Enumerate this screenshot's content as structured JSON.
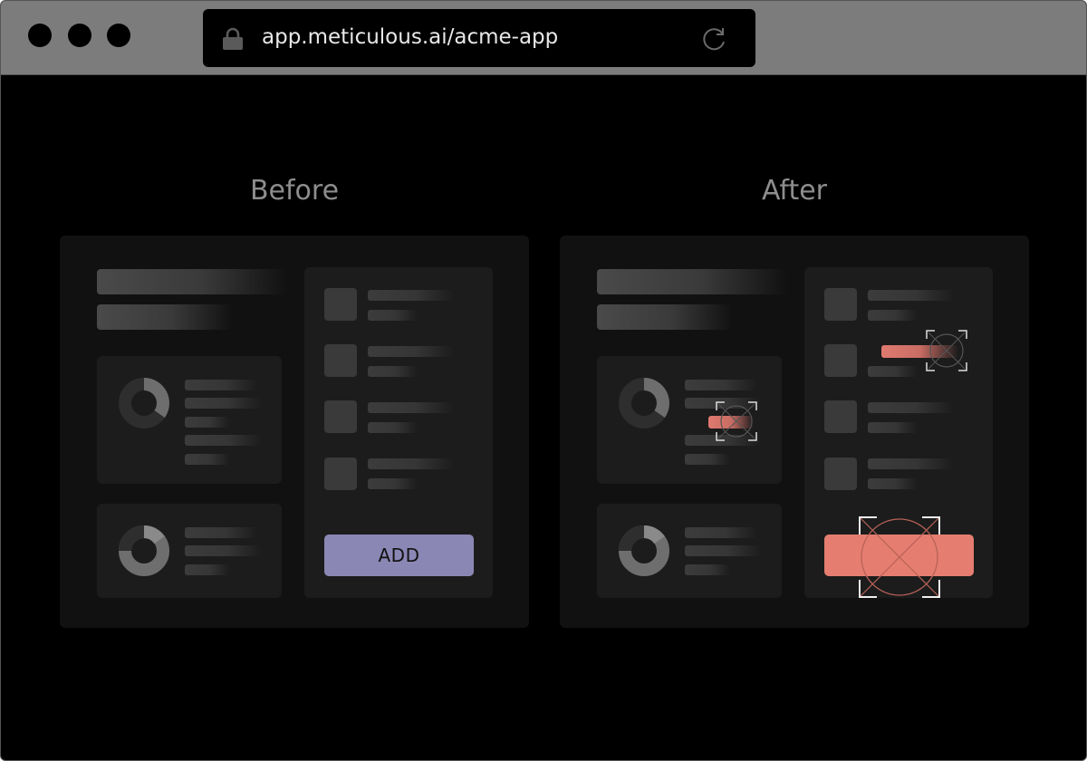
{
  "browser": {
    "url": "app.meticulous.ai/acme-app",
    "icons": [
      "lock-icon",
      "reload-icon"
    ]
  },
  "comparison": {
    "before_label": "Before",
    "after_label": "After",
    "before_button_label": "ADD",
    "after_button_label": ""
  },
  "colors": {
    "before_button": "#8b87b5",
    "after_highlight": "#e57e71",
    "donut_dark": "#2e2e2e",
    "donut_light": "#6e6e6e"
  }
}
